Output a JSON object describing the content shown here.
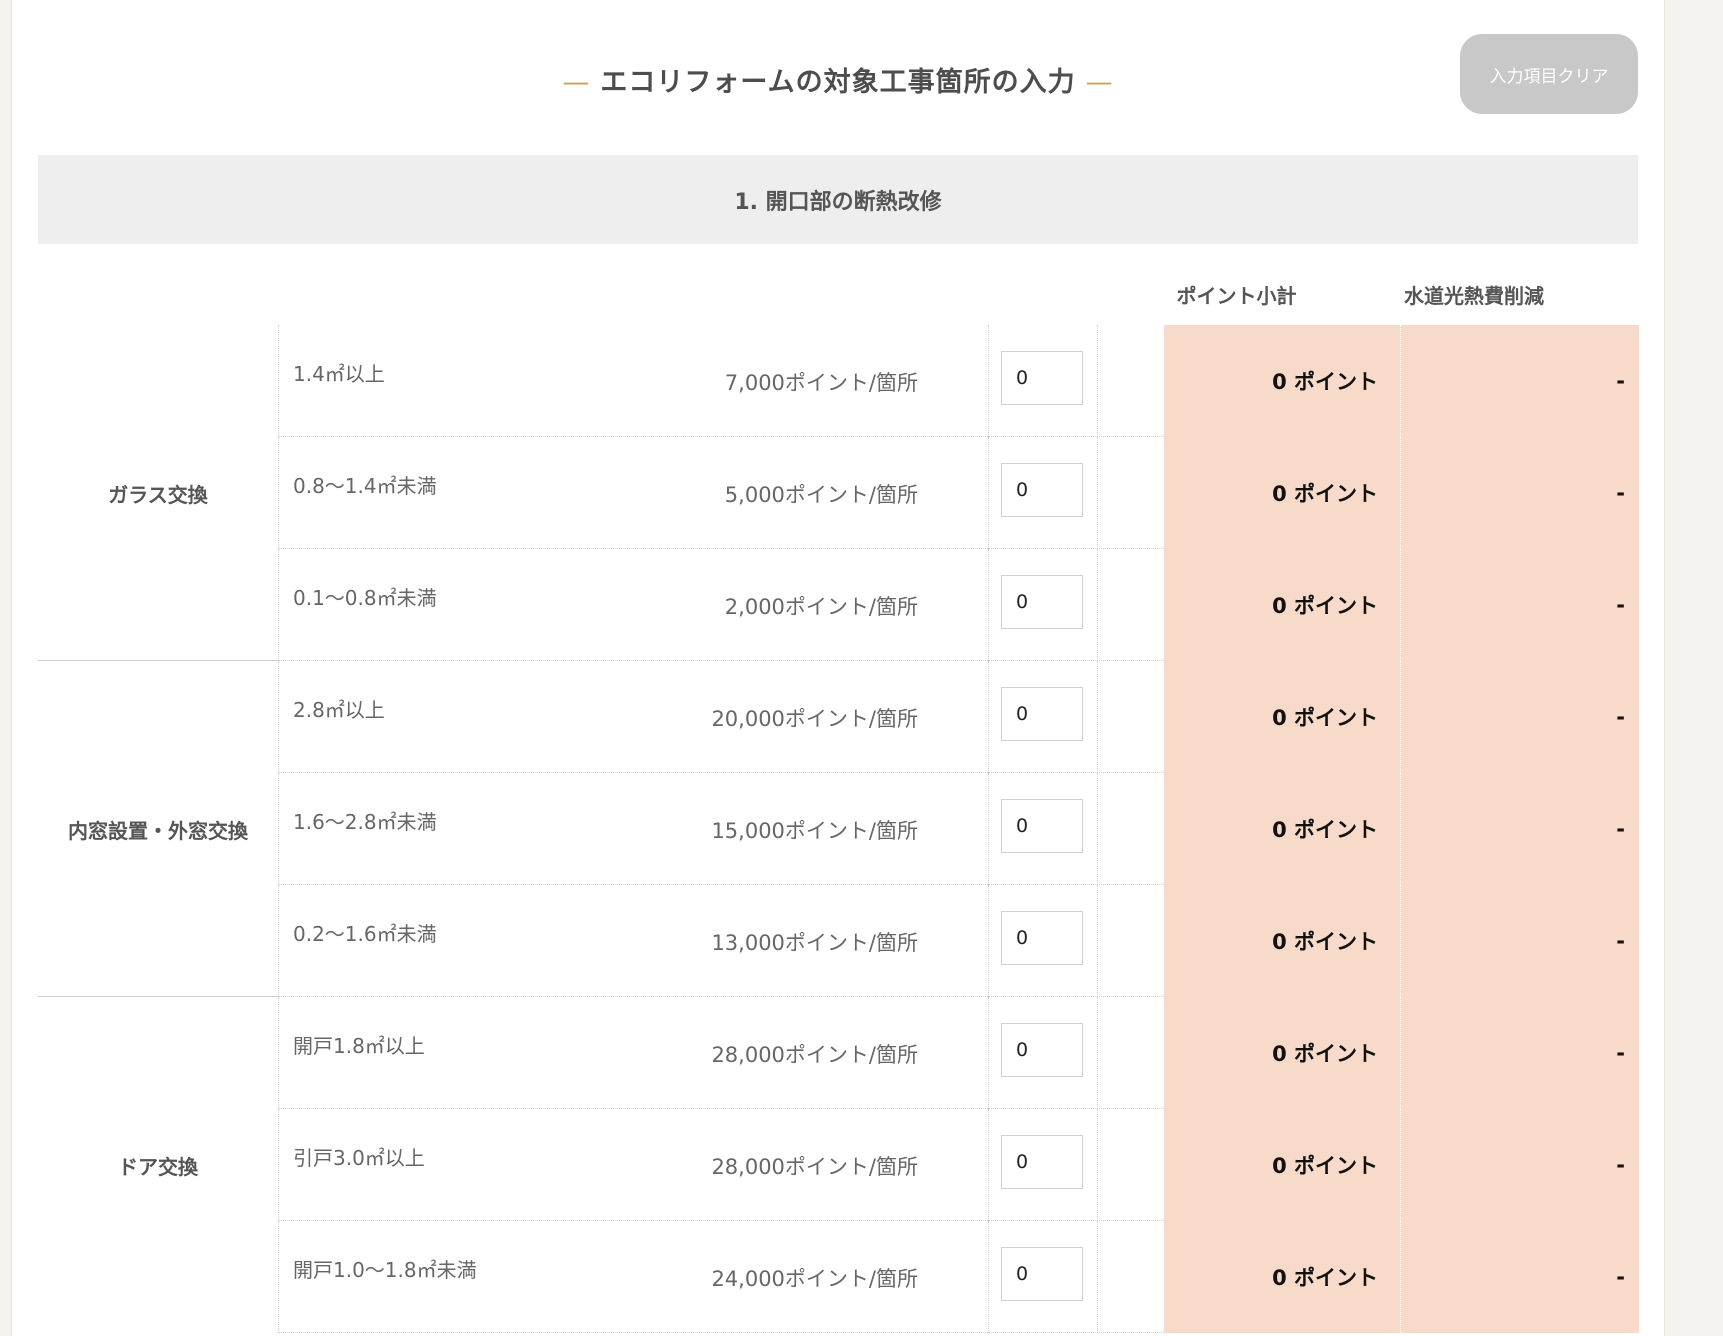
{
  "header": {
    "title": "エコリフォームの対象工事箇所の入力",
    "title_dash": "—",
    "clear_button": "入力項目クリア"
  },
  "section": {
    "title": "1. 開口部の断熱改修"
  },
  "columns": {
    "points_subtotal": "ポイント小計",
    "utility_savings": "水道光熱費削減"
  },
  "groups": [
    {
      "label": "ガラス交換",
      "rows": [
        {
          "size": "1.4㎡以上",
          "rate": "7,000ポイント/箇所",
          "qty": "0",
          "points": "0 ポイント",
          "savings": "-"
        },
        {
          "size": "0.8～1.4㎡未満",
          "rate": "5,000ポイント/箇所",
          "qty": "0",
          "points": "0 ポイント",
          "savings": "-"
        },
        {
          "size": "0.1～0.8㎡未満",
          "rate": "2,000ポイント/箇所",
          "qty": "0",
          "points": "0 ポイント",
          "savings": "-"
        }
      ]
    },
    {
      "label": "内窓設置・外窓交換",
      "rows": [
        {
          "size": "2.8㎡以上",
          "rate": "20,000ポイント/箇所",
          "qty": "0",
          "points": "0 ポイント",
          "savings": "-"
        },
        {
          "size": "1.6～2.8㎡未満",
          "rate": "15,000ポイント/箇所",
          "qty": "0",
          "points": "0 ポイント",
          "savings": "-"
        },
        {
          "size": "0.2～1.6㎡未満",
          "rate": "13,000ポイント/箇所",
          "qty": "0",
          "points": "0 ポイント",
          "savings": "-"
        }
      ]
    },
    {
      "label": "ドア交換",
      "rows": [
        {
          "size": "開戸1.8㎡以上",
          "rate": "28,000ポイント/箇所",
          "qty": "0",
          "points": "0 ポイント",
          "savings": "-"
        },
        {
          "size": "引戸3.0㎡以上",
          "rate": "28,000ポイント/箇所",
          "qty": "0",
          "points": "0 ポイント",
          "savings": "-"
        },
        {
          "size": "開戸1.0～1.8㎡未満",
          "rate": "24,000ポイント/箇所",
          "qty": "0",
          "points": "0 ポイント",
          "savings": "-"
        }
      ]
    }
  ]
}
